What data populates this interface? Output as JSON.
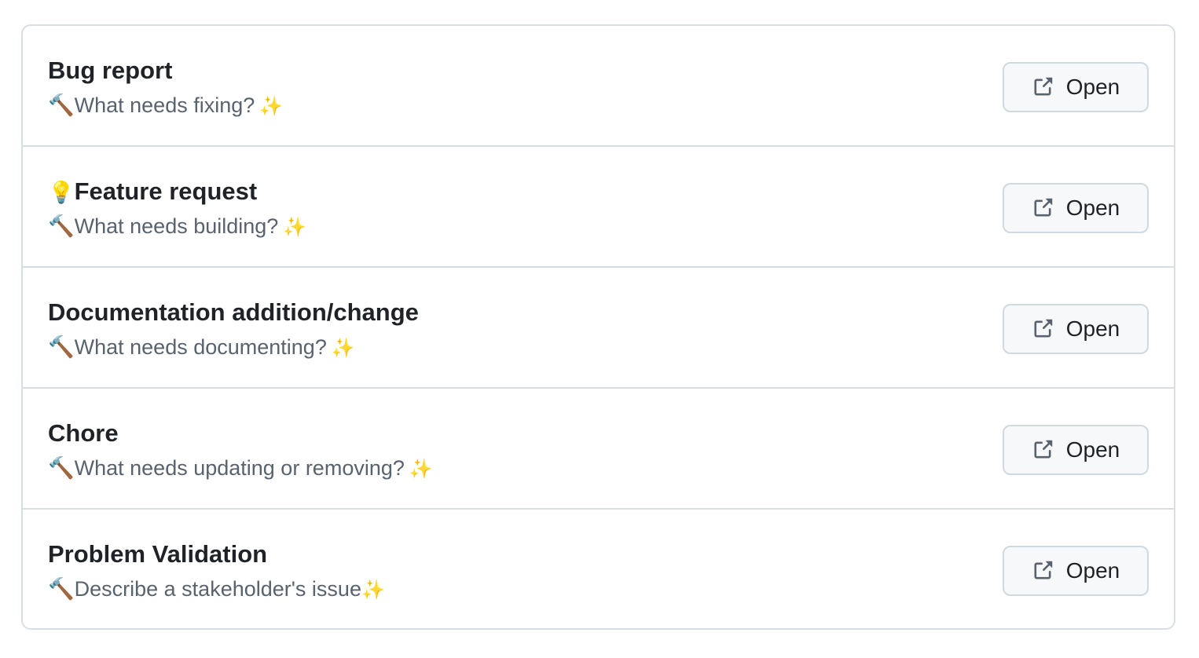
{
  "templates": [
    {
      "prefix": "",
      "title": "Bug report",
      "description_emoji": "🔨",
      "description": "What needs fixing?",
      "description_suffix": "✨",
      "button_label": "Open"
    },
    {
      "prefix": "💡",
      "title": "Feature request",
      "description_emoji": "🔨",
      "description": "What needs building?",
      "description_suffix": "✨",
      "button_label": "Open"
    },
    {
      "prefix": "",
      "title": "Documentation addition/change",
      "description_emoji": "🔨",
      "description": "What needs documenting?",
      "description_suffix": "✨",
      "button_label": "Open"
    },
    {
      "prefix": "",
      "title": "Chore",
      "description_emoji": "🔨",
      "description": "What needs updating or removing?",
      "description_suffix": "✨",
      "button_label": "Open"
    },
    {
      "prefix": "",
      "title": "Problem Validation",
      "description_emoji": "🔨",
      "description": "Describe a stakeholder's issue",
      "description_suffix": "✨",
      "button_label": "Open"
    }
  ],
  "icons": {
    "button_icon": "external-link-icon"
  },
  "colors": {
    "title": "#1f2328",
    "description": "#59636e",
    "border": "#d8dee4",
    "button_bg": "#f6f8fa"
  }
}
